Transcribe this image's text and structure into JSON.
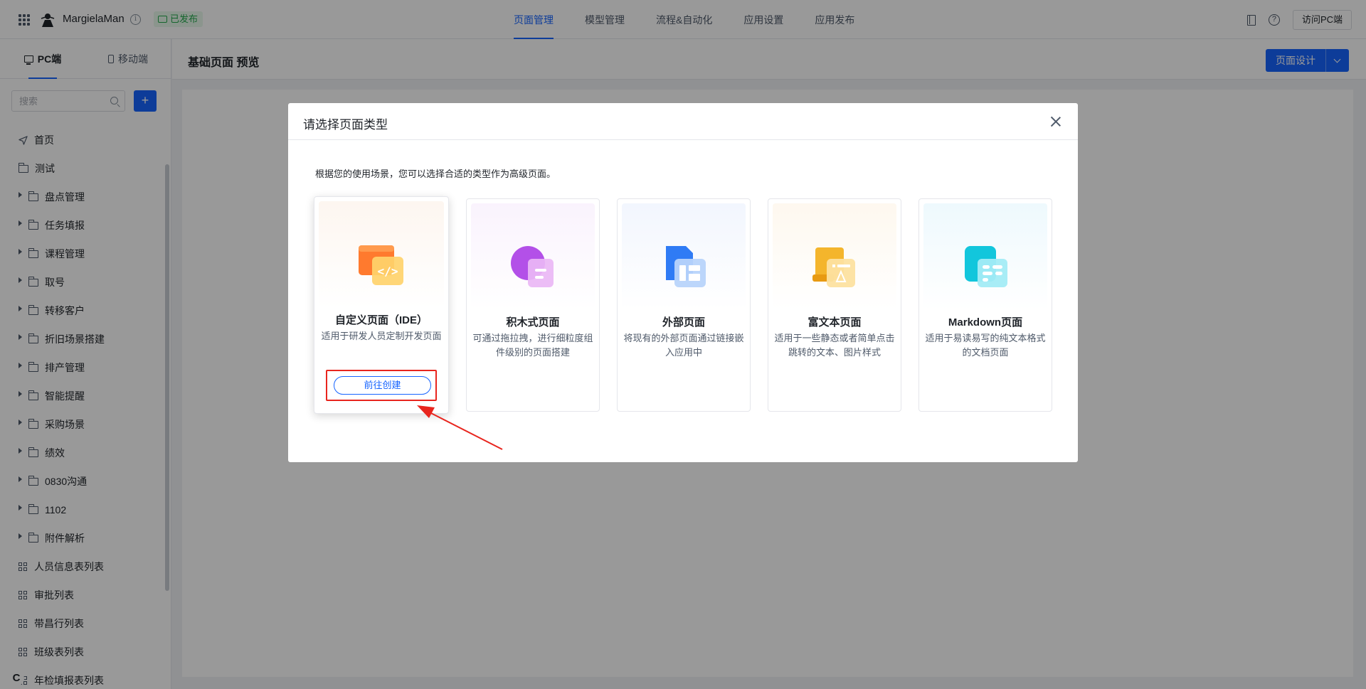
{
  "topbar": {
    "app_name": "MargielaMan",
    "status_badge": "已发布",
    "nav": [
      {
        "label": "页面管理",
        "active": true
      },
      {
        "label": "模型管理",
        "active": false
      },
      {
        "label": "流程&自动化",
        "active": false
      },
      {
        "label": "应用设置",
        "active": false
      },
      {
        "label": "应用发布",
        "active": false
      }
    ],
    "visit_label": "访问PC端"
  },
  "sidebar": {
    "tabs": [
      {
        "label": "PC端",
        "active": true
      },
      {
        "label": "移动端",
        "active": false
      }
    ],
    "search_placeholder": "搜索",
    "add_label": "+",
    "items": [
      {
        "label": "首页",
        "icon": "send-icon",
        "level": 0
      },
      {
        "label": "测试",
        "icon": "folder-icon",
        "level": 0
      },
      {
        "label": "盘点管理",
        "icon": "folder-icon",
        "level": 1
      },
      {
        "label": "任务填报",
        "icon": "folder-icon",
        "level": 1
      },
      {
        "label": "课程管理",
        "icon": "folder-icon",
        "level": 1
      },
      {
        "label": "取号",
        "icon": "folder-icon",
        "level": 1
      },
      {
        "label": "转移客户",
        "icon": "folder-icon",
        "level": 1
      },
      {
        "label": "折旧场景搭建",
        "icon": "folder-icon",
        "level": 1
      },
      {
        "label": "排产管理",
        "icon": "folder-icon",
        "level": 1
      },
      {
        "label": "智能提醒",
        "icon": "folder-icon",
        "level": 1
      },
      {
        "label": "采购场景",
        "icon": "folder-icon",
        "level": 1
      },
      {
        "label": "绩效",
        "icon": "folder-icon",
        "level": 1
      },
      {
        "label": "0830沟通",
        "icon": "folder-icon",
        "level": 1
      },
      {
        "label": "1102",
        "icon": "folder-icon",
        "level": 1
      },
      {
        "label": "附件解析",
        "icon": "folder-icon",
        "level": 1
      },
      {
        "label": "人员信息表列表",
        "icon": "grid-list-icon",
        "level": 0
      },
      {
        "label": "审批列表",
        "icon": "grid-list-icon",
        "level": 0
      },
      {
        "label": "带昌行列表",
        "icon": "grid-list-icon",
        "level": 0
      },
      {
        "label": "班级表列表",
        "icon": "grid-list-icon",
        "level": 0
      },
      {
        "label": "年检填报表列表",
        "icon": "grid-list-icon",
        "level": 0
      }
    ]
  },
  "main": {
    "title": "基础页面 预览",
    "design_button": "页面设计"
  },
  "modal": {
    "title": "请选择页面类型",
    "description": "根据您的使用场景，您可以选择合适的类型作为高级页面。",
    "cards": [
      {
        "title": "自定义页面（IDE）",
        "desc": "适用于研发人员定制开发页面",
        "icon": "code-page-icon",
        "button": "前往创建"
      },
      {
        "title": "积木式页面",
        "desc": "可通过拖拉拽，进行细粒度组件级别的页面搭建",
        "icon": "block-page-icon"
      },
      {
        "title": "外部页面",
        "desc": "将现有的外部页面通过链接嵌入应用中",
        "icon": "external-page-icon"
      },
      {
        "title": "富文本页面",
        "desc": "适用于一些静态或者简单点击跳转的文本、图片样式",
        "icon": "rich-text-page-icon"
      },
      {
        "title": "Markdown页面",
        "desc": "适用于易读易写的纯文本格式的文档页面",
        "icon": "markdown-page-icon"
      }
    ]
  },
  "colors": {
    "primary": "#1664ff",
    "published_green": "#23a94c",
    "annotation_red": "#e8251e"
  }
}
